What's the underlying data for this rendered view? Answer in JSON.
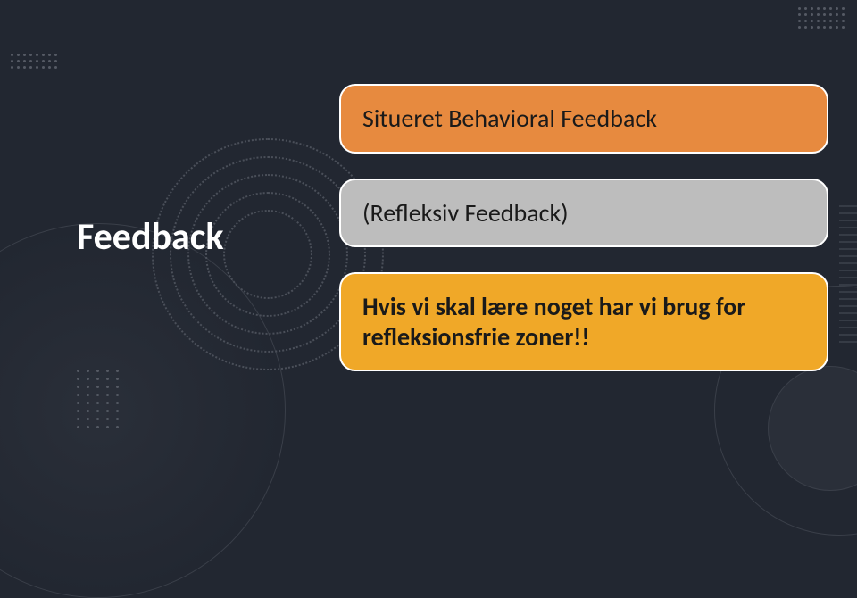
{
  "heading": "Feedback",
  "cards": {
    "first": "Situeret Behavioral Feedback",
    "second": "(Refleksiv Feedback)",
    "third": "Hvis vi skal lære noget har vi brug for refleksionsfrie zoner!!"
  }
}
